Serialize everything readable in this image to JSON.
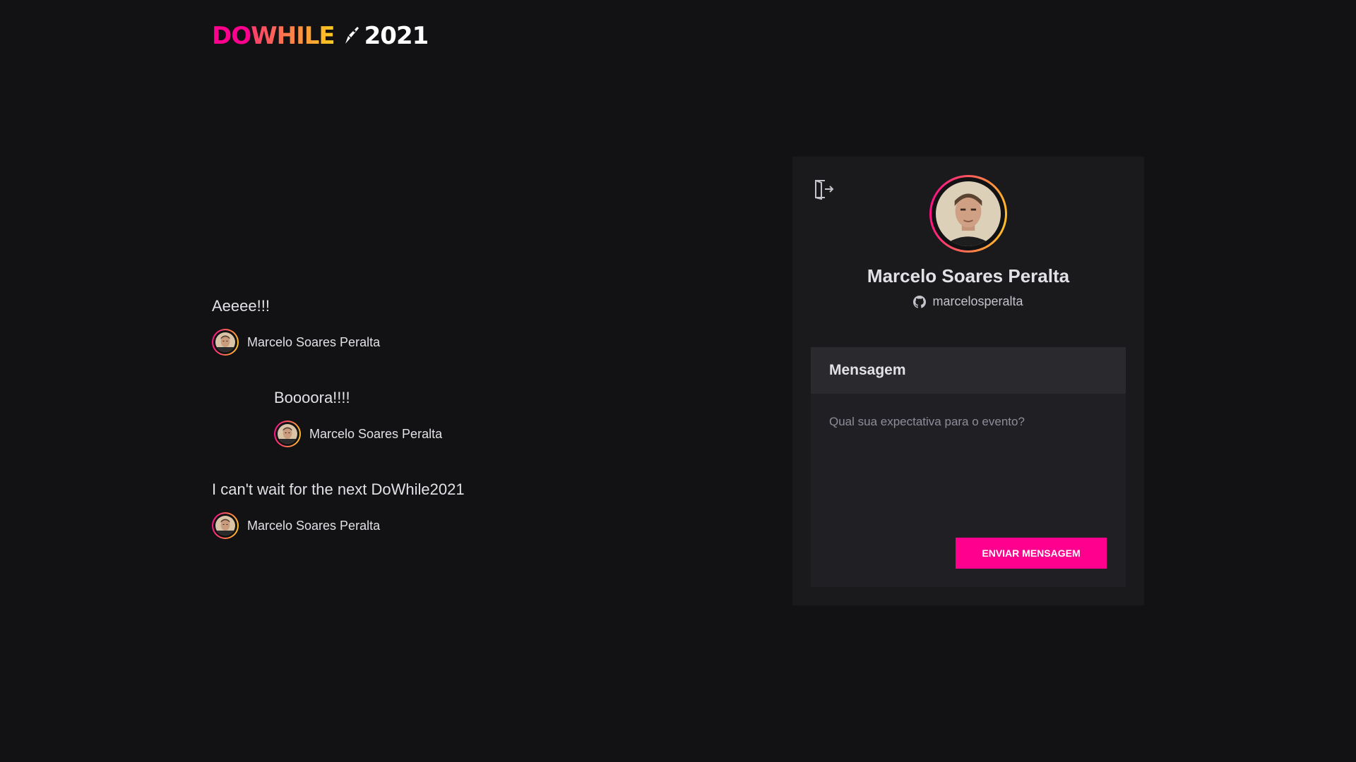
{
  "logo": {
    "do": "DO",
    "while": "WHILE",
    "year": "2021"
  },
  "colors": {
    "background": "#121214",
    "panel": "#1a1a1c",
    "accent_pink": "#ff008e",
    "accent_yellow": "#ffcd1e"
  },
  "messages": [
    {
      "content": "Aeeee!!!",
      "user_name": "Marcelo Soares Peralta",
      "avatar_icon": "user-avatar-icon"
    },
    {
      "content": "Boooora!!!!",
      "user_name": "Marcelo Soares Peralta",
      "avatar_icon": "user-avatar-icon"
    },
    {
      "content": "I can't wait for the next DoWhile2021",
      "user_name": "Marcelo Soares Peralta",
      "avatar_icon": "user-avatar-icon"
    }
  ],
  "profile": {
    "name": "Marcelo Soares Peralta",
    "github_user": "marcelosperalta",
    "github_icon": "github-icon",
    "signout_icon": "sign-out-icon"
  },
  "form": {
    "label": "Mensagem",
    "placeholder": "Qual sua expectativa para o evento?",
    "value": "",
    "submit_label": "ENVIAR MENSAGEM"
  }
}
